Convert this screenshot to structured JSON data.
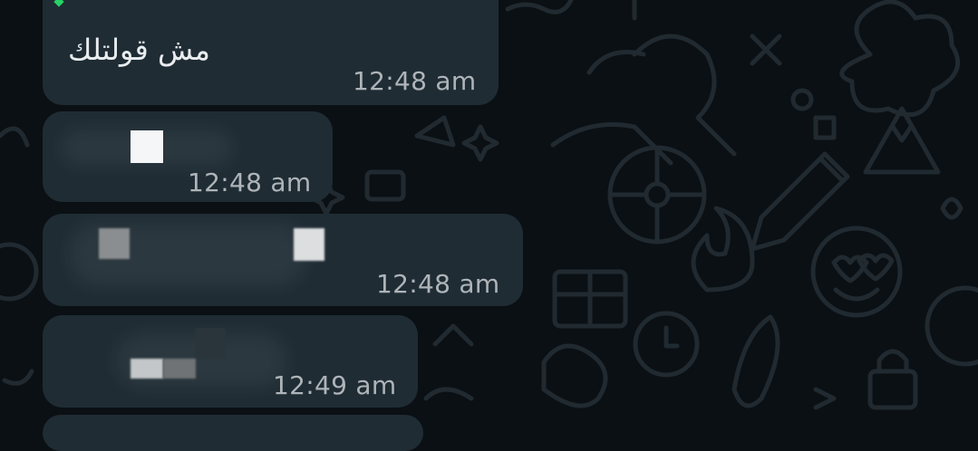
{
  "chat": {
    "messages": [
      {
        "text": "مش قولتلك",
        "time": "12:48 am"
      },
      {
        "text": "",
        "time": "12:48 am"
      },
      {
        "text": "",
        "time": "12:48 am"
      },
      {
        "text": "",
        "time": "12:49 am"
      }
    ]
  },
  "colors": {
    "chat_background": "#0b1014",
    "bubble": "#1f2c34",
    "timestamp": "#aeb4b8",
    "message_text": "#e9edef"
  }
}
